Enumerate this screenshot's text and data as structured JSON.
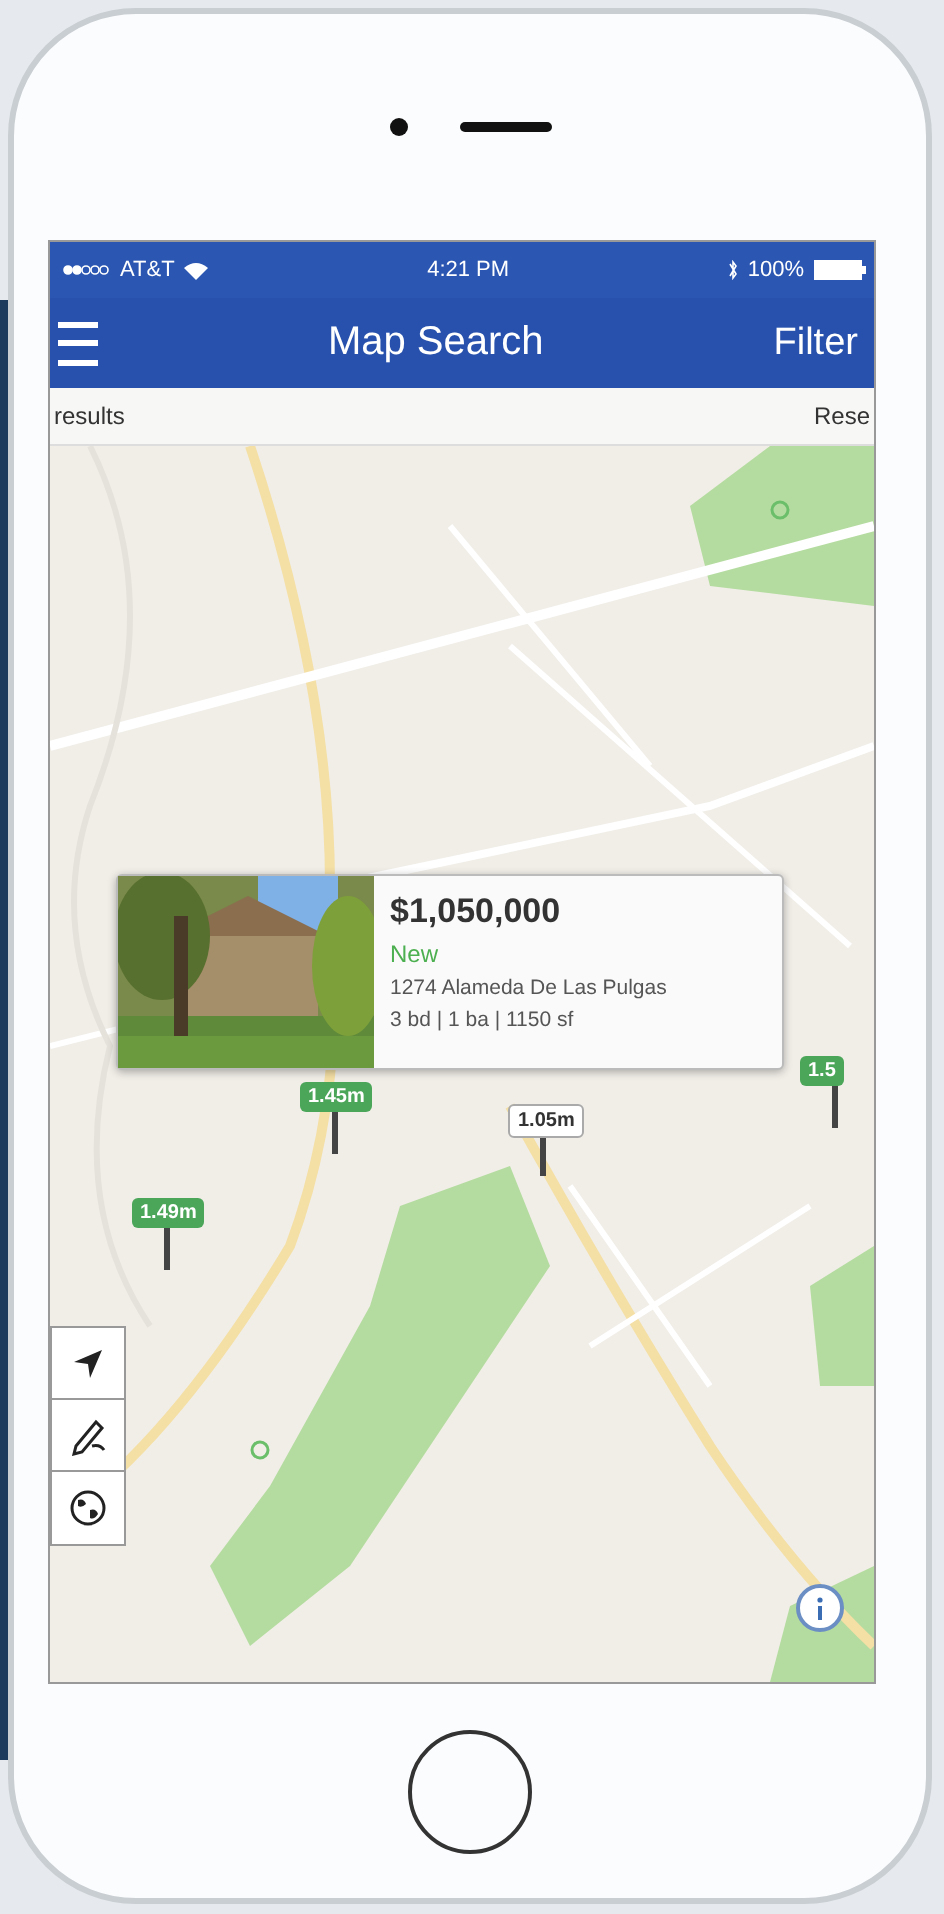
{
  "status_bar": {
    "carrier": "AT&T",
    "time": "4:21 PM",
    "battery": "100%"
  },
  "nav": {
    "title": "Map Search",
    "action": "Filter"
  },
  "results_bar": {
    "left": "results",
    "right": "Rese"
  },
  "popup": {
    "price": "$1,050,000",
    "status": "New",
    "address": "1274 Alameda De Las Pulgas",
    "details": "3 bd | 1 ba | 1150 sf"
  },
  "pins": [
    {
      "label": "1.45m",
      "selected": false
    },
    {
      "label": "1.05m",
      "selected": true
    },
    {
      "label": "1.49m",
      "selected": false
    },
    {
      "label": "1.5",
      "selected": false
    }
  ],
  "map_tools": [
    {
      "kind": "locate"
    },
    {
      "kind": "draw"
    },
    {
      "kind": "globe"
    }
  ]
}
